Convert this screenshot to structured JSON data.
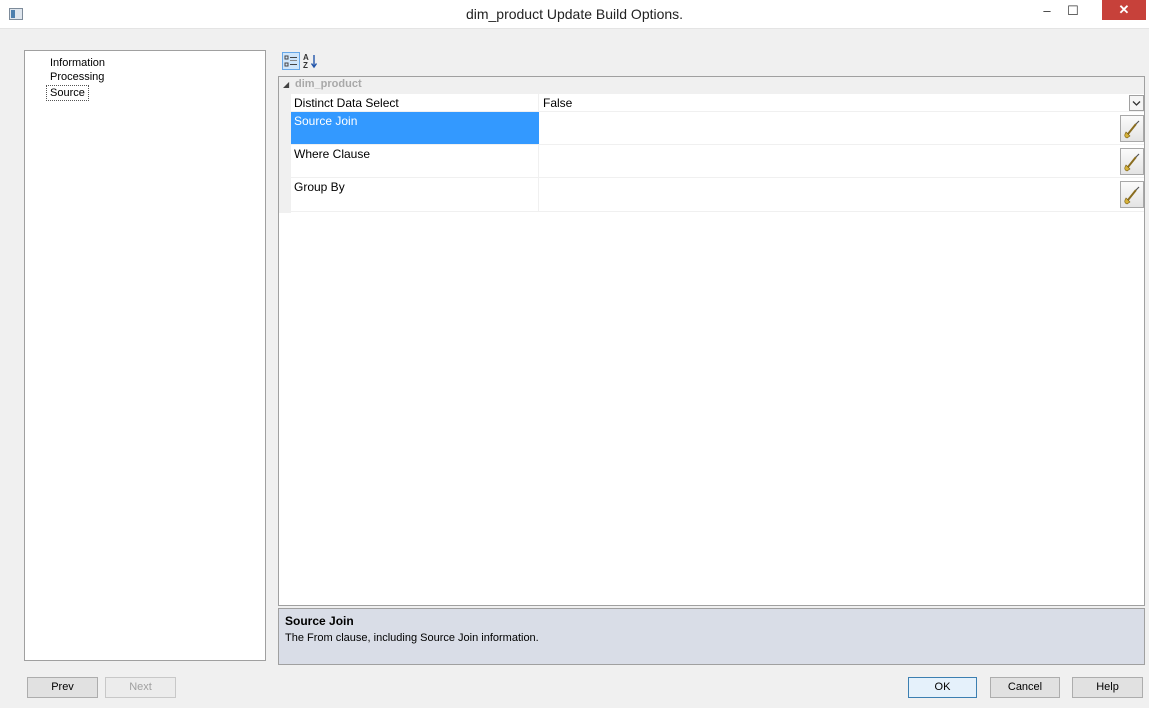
{
  "window": {
    "title": "dim_product Update Build Options.",
    "controls": {
      "minimize": "–",
      "maximize": "☐",
      "close": "✕"
    }
  },
  "nav": {
    "items": [
      {
        "label": "Information",
        "selected": false
      },
      {
        "label": "Processing",
        "selected": false
      },
      {
        "label": "Source",
        "selected": true
      }
    ]
  },
  "toolbar": {
    "categorized_icon": "categorized-icon",
    "alphabetical_icon": "sort-az-icon"
  },
  "grid": {
    "category": "dim_product",
    "properties": [
      {
        "name": "Distinct Data Select",
        "value": "False",
        "editor": "dropdown"
      },
      {
        "name": "Source Join",
        "value": "",
        "editor": "edit",
        "selected": true
      },
      {
        "name": "Where Clause",
        "value": "",
        "editor": "edit"
      },
      {
        "name": "Group By",
        "value": "",
        "editor": "edit"
      }
    ]
  },
  "help": {
    "title": "Source Join",
    "description": "The From clause, including Source Join information."
  },
  "buttons": {
    "prev": "Prev",
    "next": "Next",
    "ok": "OK",
    "cancel": "Cancel",
    "help": "Help"
  },
  "colors": {
    "selection": "#3399ff",
    "help_panel": "#d9dde7",
    "close_button": "#c7413a"
  }
}
